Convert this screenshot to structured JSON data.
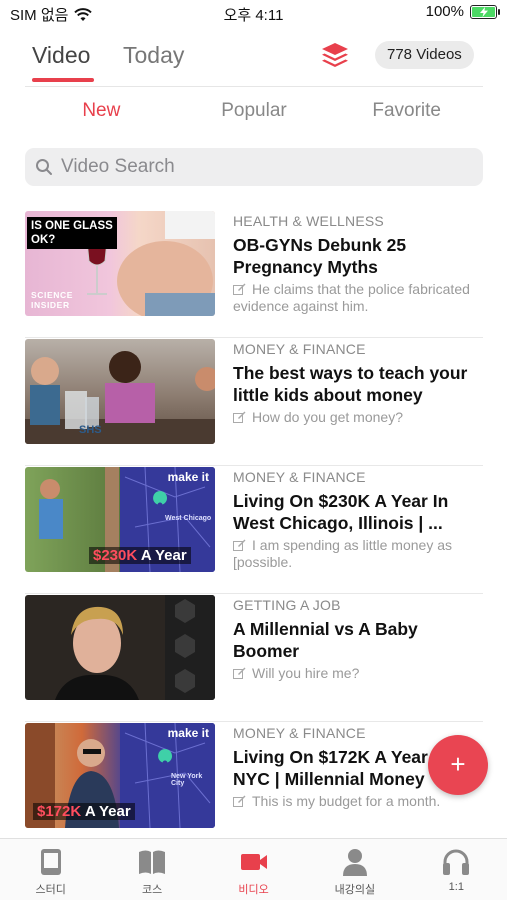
{
  "status_bar": {
    "carrier": "SIM 없음",
    "time": "오후 4:11",
    "battery": "100%",
    "battery_level": 1.0
  },
  "header": {
    "tabs": [
      {
        "label": "Video",
        "active": true
      },
      {
        "label": "Today",
        "active": false
      }
    ],
    "count_label": "778 Videos",
    "accent_color": "#e8404c"
  },
  "subtabs": [
    {
      "label": "New",
      "active": true
    },
    {
      "label": "Popular",
      "active": false
    },
    {
      "label": "Favorite",
      "active": false
    }
  ],
  "search": {
    "placeholder": "Video Search",
    "value": ""
  },
  "videos": [
    {
      "category": "HEALTH & WELLNESS",
      "title": "OB-GYNs Debunk 25 Pregnancy Myths",
      "description": "He claims that the police fabricated evidence against him.",
      "thumb_text": [
        "IS ONE GLASS",
        "OK?"
      ],
      "thumb_brand": [
        "SCIENCE",
        "INSIDER"
      ]
    },
    {
      "category": "MONEY & FINANCE",
      "title": "The best ways to teach your little kids about money",
      "description": "How do you get money?",
      "thumb_text": [
        "SHS"
      ]
    },
    {
      "category": "MONEY & FINANCE",
      "title": "Living On $230K A Year In West Chicago, Illinois | ...",
      "description": "I am spending as little money as [possible.",
      "thumb_price": "$230K",
      "thumb_suffix": "A Year",
      "thumb_brand": "make it",
      "thumb_map_label": "West Chicago"
    },
    {
      "category": "GETTING A JOB",
      "title": "A Millennial vs A Baby Boomer",
      "description": "Will you hire me?"
    },
    {
      "category": "MONEY & FINANCE",
      "title": "Living On $172K A Year In NYC | Millennial Money",
      "description": "This is my budget for a month.",
      "thumb_price": "$172K",
      "thumb_suffix": "A Year",
      "thumb_brand": "make it",
      "thumb_map_label": "New York City"
    }
  ],
  "fab": {
    "label": "+"
  },
  "bottom_nav": [
    {
      "label": "스터디",
      "icon": "study-icon",
      "active": false
    },
    {
      "label": "코스",
      "icon": "book-icon",
      "active": false
    },
    {
      "label": "비디오",
      "icon": "video-camera-icon",
      "active": true
    },
    {
      "label": "내강의실",
      "icon": "person-icon",
      "active": false
    },
    {
      "label": "1:1",
      "icon": "headphones-icon",
      "active": false
    }
  ]
}
